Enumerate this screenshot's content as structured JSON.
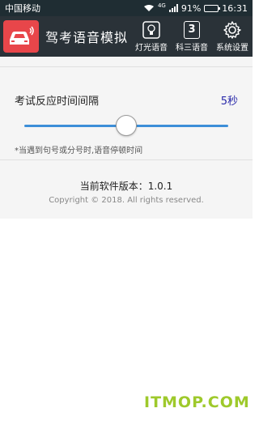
{
  "statusbar": {
    "carrier": "中国移动",
    "network": "4G",
    "battery": "91%",
    "battery_level": 0.91,
    "time": "16:31"
  },
  "appbar": {
    "title": "驾考语音模拟",
    "buttons": [
      {
        "label": "灯光语音",
        "icon": "bulb-icon"
      },
      {
        "label": "科三语音",
        "icon": "number-3-icon",
        "icon_text": "3"
      },
      {
        "label": "系统设置",
        "icon": "gear-icon"
      }
    ]
  },
  "settings": {
    "interval_label": "考试反应时间间隔",
    "interval_value": "5秒",
    "slider_level": 0.5,
    "hint": "*当遇到句号或分号时,语音停顿时间"
  },
  "about": {
    "version": "当前软件版本：1.0.1",
    "copyright": "Copyright © 2018. All rights reserved."
  },
  "watermark": "ITMOP.COM",
  "colors": {
    "appbar": "#2a3238",
    "statusbar": "#1f2d33",
    "accent": "#3d8fd8",
    "logo": "#e8464a",
    "value": "#2a2aaa"
  }
}
